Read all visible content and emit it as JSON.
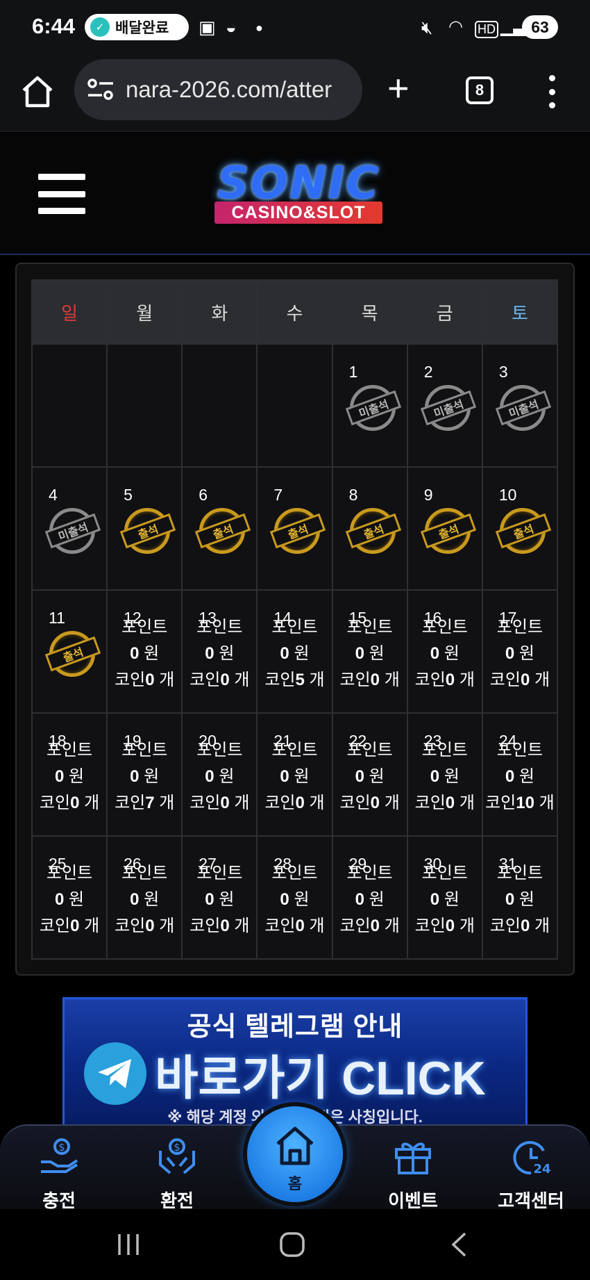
{
  "status_bar": {
    "time": "6:44",
    "delivery_label": "배달완료",
    "battery": "63"
  },
  "browser": {
    "url": "nara-2026.com/atter",
    "tab_count": "8"
  },
  "logo": {
    "main": "SONIC",
    "sub": "CASINO&SLOT"
  },
  "calendar": {
    "weekdays": [
      "일",
      "월",
      "화",
      "수",
      "목",
      "금",
      "토"
    ],
    "point_label": "포인트",
    "won_unit": "원",
    "coin_label": "코인",
    "count_unit": "개",
    "absent_label": "미출석",
    "present_label": "출석",
    "weeks": [
      [
        {
          "day": ""
        },
        {
          "day": ""
        },
        {
          "day": ""
        },
        {
          "day": ""
        },
        {
          "day": "1",
          "stamp": "absent"
        },
        {
          "day": "2",
          "stamp": "absent"
        },
        {
          "day": "3",
          "stamp": "absent"
        }
      ],
      [
        {
          "day": "4",
          "stamp": "absent"
        },
        {
          "day": "5",
          "stamp": "present"
        },
        {
          "day": "6",
          "stamp": "present"
        },
        {
          "day": "7",
          "stamp": "present"
        },
        {
          "day": "8",
          "stamp": "present"
        },
        {
          "day": "9",
          "stamp": "present"
        },
        {
          "day": "10",
          "stamp": "present"
        }
      ],
      [
        {
          "day": "11",
          "stamp": "present"
        },
        {
          "day": "12",
          "points": "0",
          "coins": "0"
        },
        {
          "day": "13",
          "points": "0",
          "coins": "0"
        },
        {
          "day": "14",
          "points": "0",
          "coins": "5"
        },
        {
          "day": "15",
          "points": "0",
          "coins": "0"
        },
        {
          "day": "16",
          "points": "0",
          "coins": "0"
        },
        {
          "day": "17",
          "points": "0",
          "coins": "0"
        }
      ],
      [
        {
          "day": "18",
          "points": "0",
          "coins": "0"
        },
        {
          "day": "19",
          "points": "0",
          "coins": "7"
        },
        {
          "day": "20",
          "points": "0",
          "coins": "0"
        },
        {
          "day": "21",
          "points": "0",
          "coins": "0"
        },
        {
          "day": "22",
          "points": "0",
          "coins": "0"
        },
        {
          "day": "23",
          "points": "0",
          "coins": "0"
        },
        {
          "day": "24",
          "points": "0",
          "coins": "10"
        }
      ],
      [
        {
          "day": "25",
          "points": "0",
          "coins": "0"
        },
        {
          "day": "26",
          "points": "0",
          "coins": "0"
        },
        {
          "day": "27",
          "points": "0",
          "coins": "0"
        },
        {
          "day": "28",
          "points": "0",
          "coins": "0"
        },
        {
          "day": "29",
          "points": "0",
          "coins": "0"
        },
        {
          "day": "30",
          "points": "0",
          "coins": "0"
        },
        {
          "day": "31",
          "points": "0",
          "coins": "0"
        }
      ]
    ]
  },
  "telegram_banner": {
    "title": "공식 텔레그램 안내",
    "cta": "바로가기 CLICK",
    "note": "※ 해당 계정 외 사칭 계정은 사칭입니다."
  },
  "bottom_nav": {
    "deposit": "충전",
    "withdraw": "환전",
    "home": "홈",
    "event": "이벤트",
    "support": "고객센터"
  },
  "colors": {
    "sunday": "#e23a3a",
    "saturday": "#6bb8f0",
    "present_gold": "#e6b730",
    "absent_gray": "#8a8a8a",
    "accent_blue": "#2f8cff"
  }
}
